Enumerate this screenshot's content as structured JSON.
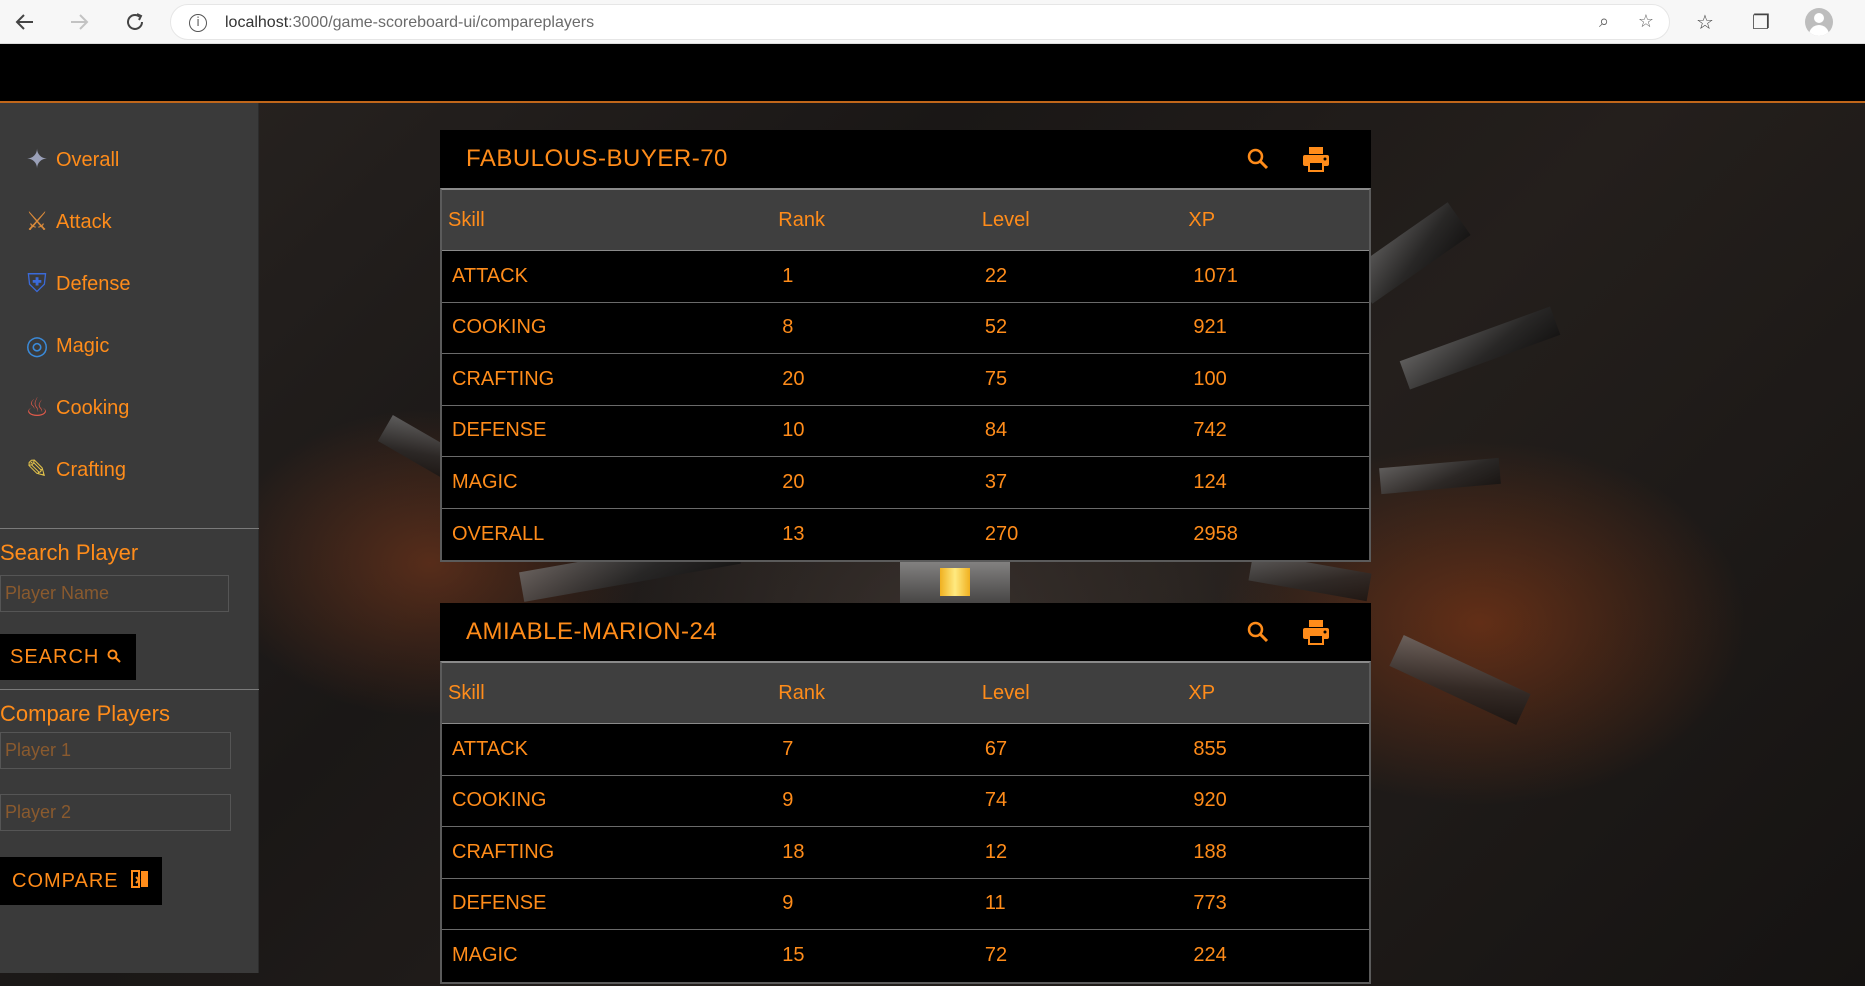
{
  "browser": {
    "url_host": "localhost",
    "url_rest": ":3000/game-scoreboard-ui/compareplayers",
    "back_icon": "arrow-left-icon",
    "forward_icon": "arrow-right-icon",
    "reload_icon": "reload-icon"
  },
  "sidebar": {
    "items": [
      {
        "label": "Overall",
        "icon": "overall-icon",
        "glyph": "✦",
        "color": "#9aa0b8"
      },
      {
        "label": "Attack",
        "icon": "attack-icon",
        "glyph": "⚔",
        "color": "#d98a3a"
      },
      {
        "label": "Defense",
        "icon": "defense-icon",
        "glyph": "⛨",
        "color": "#3a6ad9"
      },
      {
        "label": "Magic",
        "icon": "magic-icon",
        "glyph": "◎",
        "color": "#3a8ad9"
      },
      {
        "label": "Cooking",
        "icon": "cooking-icon",
        "glyph": "♨",
        "color": "#e05a4a"
      },
      {
        "label": "Crafting",
        "icon": "crafting-icon",
        "glyph": "✎",
        "color": "#e0c04a"
      }
    ],
    "search": {
      "heading": "Search Player",
      "placeholder": "Player Name",
      "button_label": "SEARCH"
    },
    "compare": {
      "heading": "Compare Players",
      "player1_placeholder": "Player 1",
      "player2_placeholder": "Player 2",
      "button_label": "COMPARE"
    }
  },
  "columns": [
    "Skill",
    "Rank",
    "Level",
    "XP"
  ],
  "players": [
    {
      "name": "FABULOUS-BUYER-70",
      "rows": [
        [
          "ATTACK",
          "1",
          "22",
          "1071"
        ],
        [
          "COOKING",
          "8",
          "52",
          "921"
        ],
        [
          "CRAFTING",
          "20",
          "75",
          "100"
        ],
        [
          "DEFENSE",
          "10",
          "84",
          "742"
        ],
        [
          "MAGIC",
          "20",
          "37",
          "124"
        ],
        [
          "OVERALL",
          "13",
          "270",
          "2958"
        ]
      ]
    },
    {
      "name": "AMIABLE-MARION-24",
      "rows": [
        [
          "ATTACK",
          "7",
          "67",
          "855"
        ],
        [
          "COOKING",
          "9",
          "74",
          "920"
        ],
        [
          "CRAFTING",
          "18",
          "12",
          "188"
        ],
        [
          "DEFENSE",
          "9",
          "11",
          "773"
        ],
        [
          "MAGIC",
          "15",
          "72",
          "224"
        ]
      ]
    }
  ]
}
